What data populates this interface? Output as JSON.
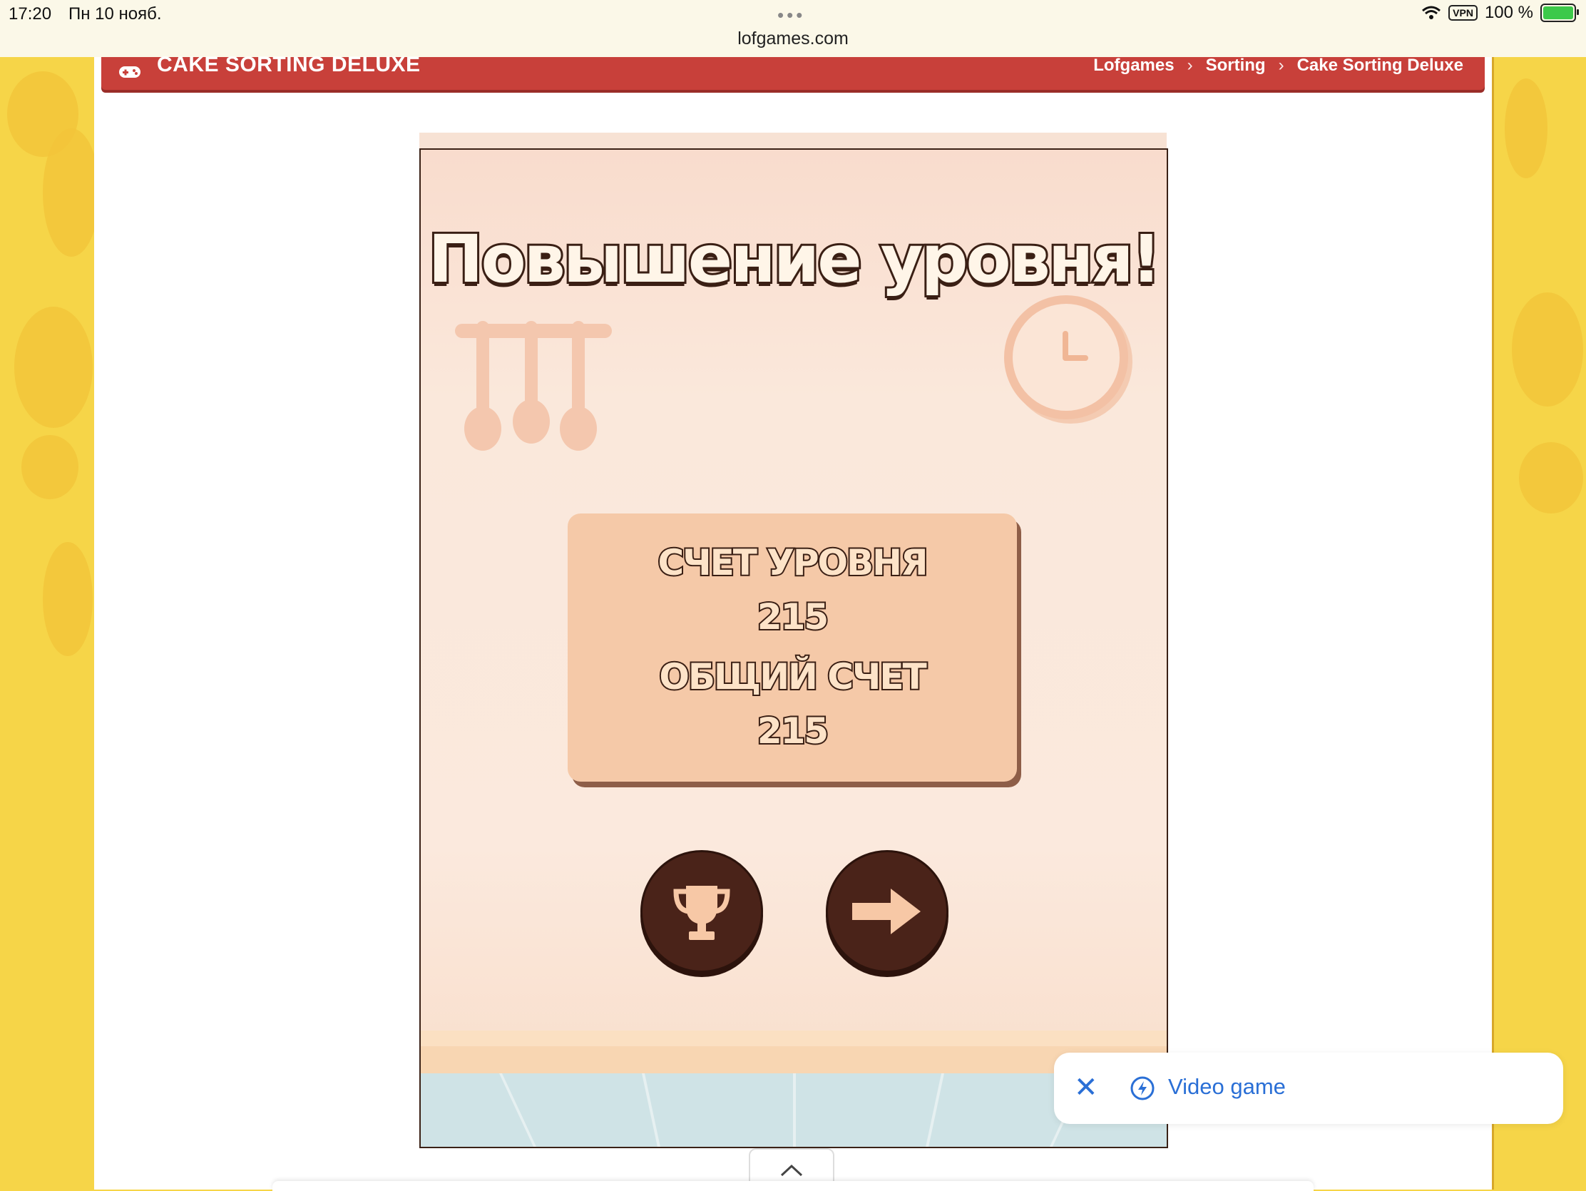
{
  "status_bar": {
    "time": "17:20",
    "date": "Пн 10 нояб.",
    "url": "lofgames.com",
    "vpn": "VPN",
    "battery": "100 %"
  },
  "header": {
    "title": "CAKE SORTING DELUXE",
    "breadcrumbs": [
      "Lofgames",
      "Sorting",
      "Cake Sorting Deluxe"
    ]
  },
  "game": {
    "title": "Повышение уровня!",
    "level_score_label": "СЧЕТ УРОВНЯ",
    "level_score": "215",
    "total_score_label": "ОБЩИЙ СЧЕТ",
    "total_score": "215",
    "buttons": [
      "trophy-icon",
      "arrow-right-icon"
    ]
  },
  "chip": {
    "label": "Video game"
  },
  "colors": {
    "header_red": "#c8403a",
    "button_brown": "#4a2319",
    "panel_peach": "#f5c9a8",
    "link_blue": "#2a6fd6"
  }
}
